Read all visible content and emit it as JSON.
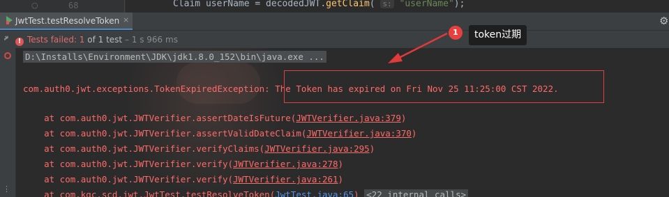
{
  "editor": {
    "line_number": "68",
    "code_prefix": "Claim userName = decodedJWT.",
    "code_method": "getClaim",
    "code_open": "( ",
    "param_hint": "s:",
    "code_arg": " \"userName\"",
    "code_close": ");"
  },
  "run_tab": {
    "label": "JwtTest.testResolveToken",
    "close": "×"
  },
  "status": {
    "failed_label": "Tests failed: 1",
    "of_label": " of 1 test",
    "duration": " – 1 s 966 ms",
    "icon": "!"
  },
  "console": {
    "command": "D:\\Installs\\Environment\\JDK\\jdk1.8.0_152\\bin\\java.exe ...",
    "exception_class": "com.auth0.jwt.exceptions.TokenExpiredException:",
    "exception_message": " The Token has expired on Fri Nov 25 11:25:00 CST 2022.",
    "stack": [
      {
        "prefix": "    at com.auth0.jwt.JWTVerifier.assertDateIsFuture(",
        "link": "JWTVerifier.java:379",
        "suffix": ")"
      },
      {
        "prefix": "    at com.auth0.jwt.JWTVerifier.assertValidDateClaim(",
        "link": "JWTVerifier.java:370",
        "suffix": ")"
      },
      {
        "prefix": "    at com.auth0.jwt.JWTVerifier.verifyClaims(",
        "link": "JWTVerifier.java:295",
        "suffix": ")"
      },
      {
        "prefix": "    at com.auth0.jwt.JWTVerifier.verify(",
        "link": "JWTVerifier.java:278",
        "suffix": ")"
      },
      {
        "prefix": "    at com.auth0.jwt.JWTVerifier.verify(",
        "link": "JWTVerifier.java:261",
        "suffix": ")"
      }
    ],
    "last_line": {
      "prefix": "    at com.kgc.scd.jwt.JwtTest.testResolveToken(",
      "link": "JwtTest.java:65",
      "suffix": ") ",
      "internal": "<22 internal calls>"
    }
  },
  "annotation": {
    "badge": "1",
    "callout": "token过期"
  },
  "icons": {
    "gear": "gear-icon",
    "rerun": "rerun-icon",
    "stop": "stop-icon"
  },
  "colors": {
    "error_text": "#ff6b68",
    "annotation_red": "#e04040",
    "link_blue": "#5394ec",
    "background": "#2b2b2b"
  }
}
